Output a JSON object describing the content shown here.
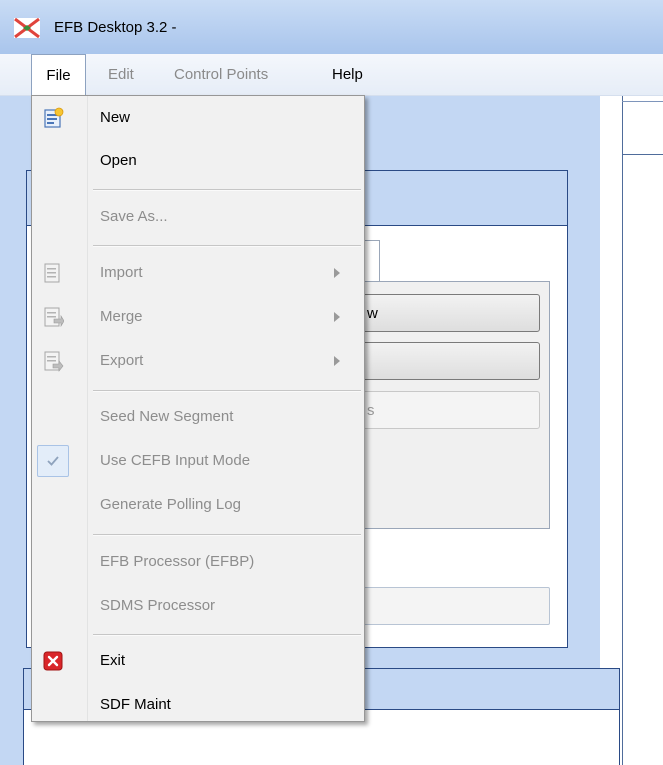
{
  "window": {
    "title": "EFB Desktop 3.2 -"
  },
  "menubar": {
    "items": [
      {
        "label": "File"
      },
      {
        "label": "Edit"
      },
      {
        "label": "Control Points"
      },
      {
        "label": "Help"
      }
    ]
  },
  "file_menu": {
    "items": [
      {
        "label": "New",
        "enabled": true,
        "icon": "new-document-icon"
      },
      {
        "label": "Open",
        "enabled": true
      },
      {
        "label": "Save As...",
        "enabled": false
      },
      {
        "label": "Import",
        "enabled": false,
        "submenu": true,
        "icon": "import-icon"
      },
      {
        "label": "Merge",
        "enabled": false,
        "submenu": true,
        "icon": "merge-icon"
      },
      {
        "label": "Export",
        "enabled": false,
        "submenu": true,
        "icon": "export-icon"
      },
      {
        "label": "Seed New Segment",
        "enabled": false
      },
      {
        "label": "Use CEFB Input Mode",
        "enabled": false,
        "checked": true
      },
      {
        "label": "Generate Polling Log",
        "enabled": false
      },
      {
        "label": "EFB Processor (EFBP)",
        "enabled": false
      },
      {
        "label": "SDMS Processor",
        "enabled": false
      },
      {
        "label": "Exit",
        "enabled": true,
        "icon": "exit-icon"
      },
      {
        "label": "SDF Maint",
        "enabled": true
      }
    ]
  },
  "background": {
    "partial_button_text": "w",
    "partial_button_text_2": "s"
  },
  "colors": {
    "titlebar": "#b7cff0",
    "panel_border": "#2a4a85",
    "background_blue": "#c3d7f3",
    "exit_icon_red": "#d9262a"
  }
}
